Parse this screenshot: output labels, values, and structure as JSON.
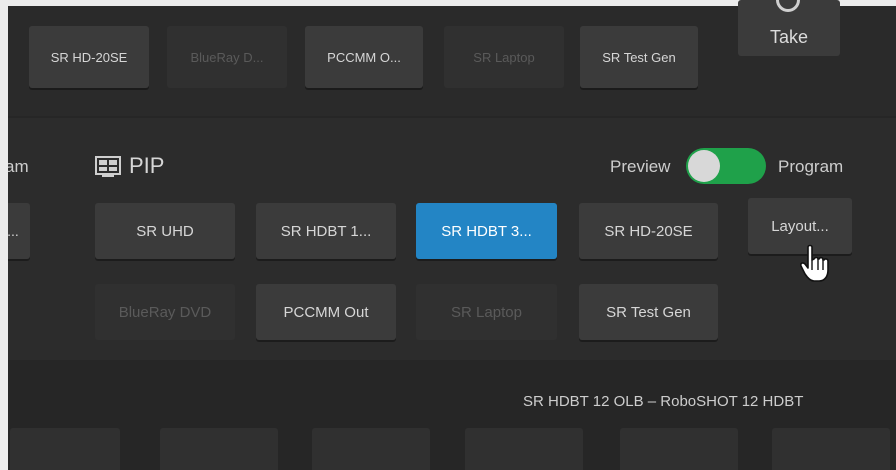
{
  "top_row": {
    "buttons": [
      {
        "label": "SR HD-20SE",
        "enabled": true
      },
      {
        "label": "BlueRay D...",
        "enabled": false
      },
      {
        "label": "PCCMM O...",
        "enabled": true
      },
      {
        "label": "SR Laptop",
        "enabled": false
      },
      {
        "label": "SR Test Gen",
        "enabled": true
      }
    ],
    "take_label": "Take"
  },
  "pip": {
    "left_partial_label": "am",
    "left_partial_button": "...",
    "title": "PIP",
    "preview_label": "Preview",
    "program_label": "Program",
    "toggle_state": "program",
    "row1": [
      {
        "label": "SR UHD",
        "selected": false
      },
      {
        "label": "SR HDBT 1...",
        "selected": false
      },
      {
        "label": "SR HDBT 3...",
        "selected": true
      },
      {
        "label": "SR HD-20SE",
        "selected": false
      }
    ],
    "row2": [
      {
        "label": "BlueRay DVD",
        "enabled": false
      },
      {
        "label": "PCCMM Out",
        "enabled": true
      },
      {
        "label": "SR Laptop",
        "enabled": false
      },
      {
        "label": "SR Test Gen",
        "enabled": true
      }
    ],
    "layout_button": "Layout..."
  },
  "status": {
    "source_text": "SR HDBT 12 OLB – RoboSHOT 12 HDBT"
  },
  "colors": {
    "selected": "#2385c5",
    "toggle_on": "#1fa14a",
    "button": "#3b3b3b",
    "background": "#2c2c2c"
  }
}
